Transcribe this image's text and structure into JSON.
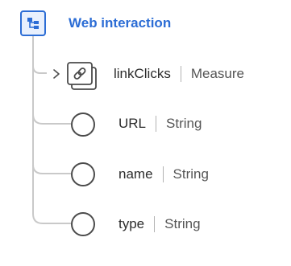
{
  "root": {
    "title": "Web interaction",
    "icon": "object-hierarchy-icon",
    "accent_color": "#2c6dd5"
  },
  "fields": [
    {
      "name": "linkClicks",
      "type": "Measure",
      "icon": "link-icon",
      "expandable": true
    },
    {
      "name": "URL",
      "type": "String",
      "icon": "circle-icon",
      "expandable": false
    },
    {
      "name": "name",
      "type": "String",
      "icon": "circle-icon",
      "expandable": false
    },
    {
      "name": "type",
      "type": "String",
      "icon": "circle-icon",
      "expandable": false
    }
  ]
}
